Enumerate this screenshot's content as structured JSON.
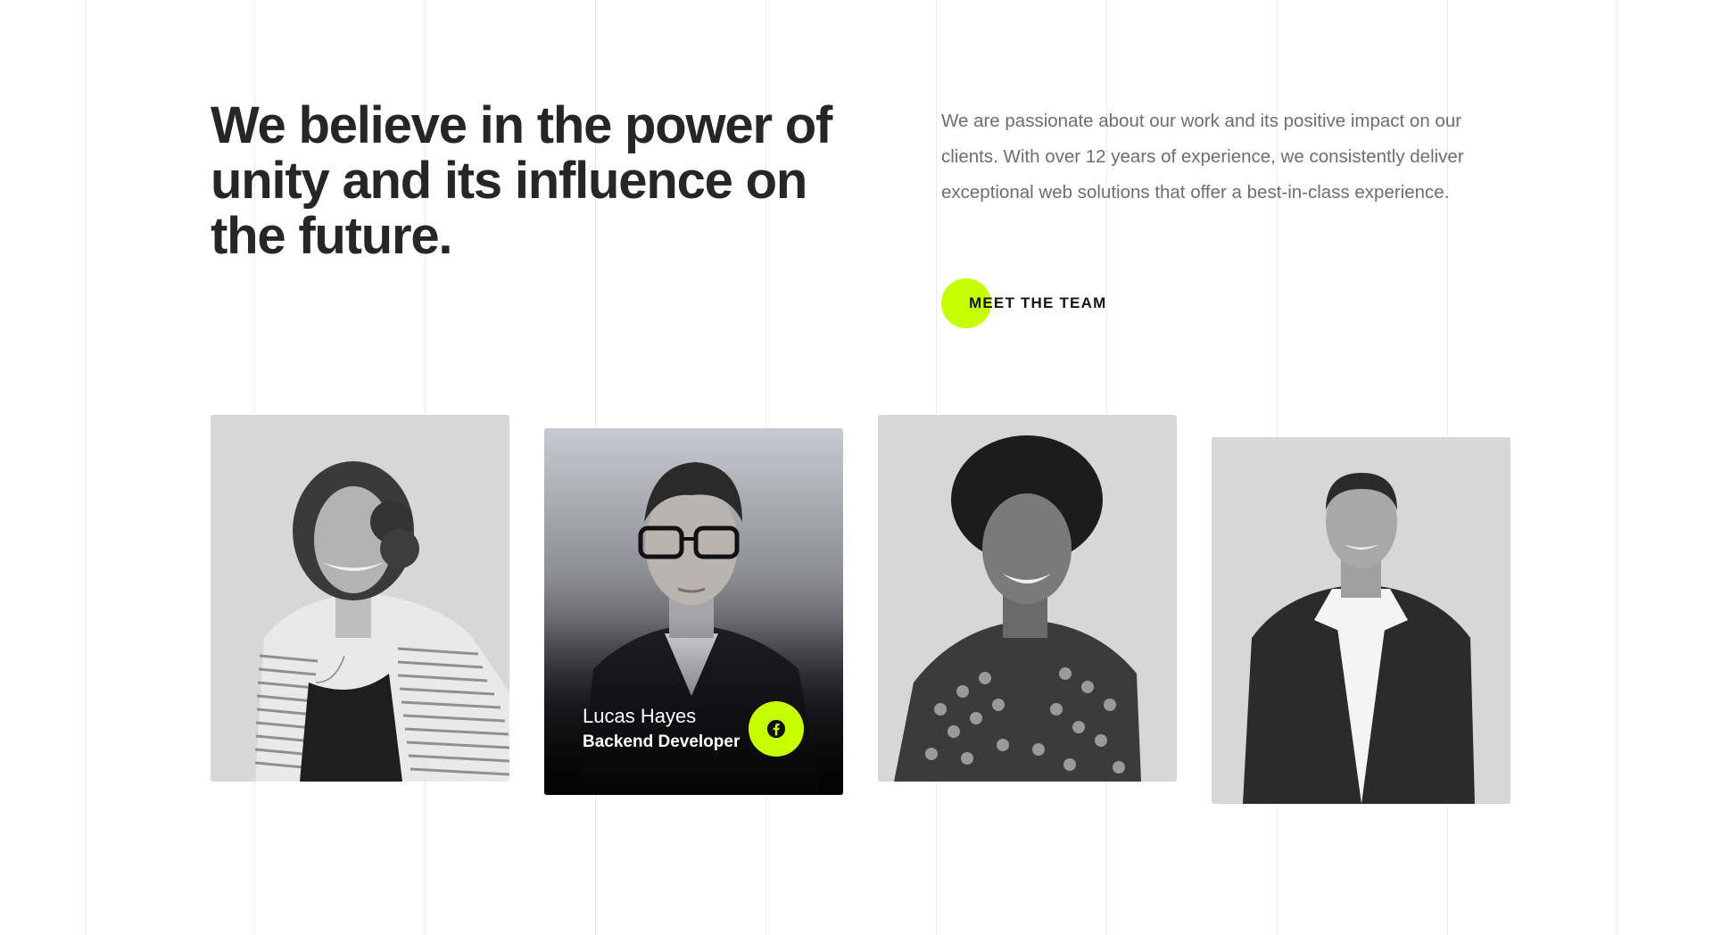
{
  "hero": {
    "headline": "We believe in the power of unity and its influence on the future.",
    "intro": "We are passionate about our work and its positive impact on our clients. With over 12 years of experience, we consistently deliver exceptional web solutions that offer a best-in-class experience.",
    "cta_label": "MEET THE TEAM"
  },
  "team": {
    "members": [
      {
        "photo": "woman-curly-hair-portrait"
      },
      {
        "photo": "man-glasses-portrait",
        "name": "Lucas Hayes",
        "role": "Backend Developer",
        "social_icon": "facebook-icon"
      },
      {
        "photo": "woman-afro-portrait"
      },
      {
        "photo": "man-suit-portrait"
      }
    ]
  },
  "colors": {
    "accent": "#c6ff00",
    "heading": "#262626",
    "body_text": "#6e6e6e",
    "grid_lines": "#ececec",
    "card_bg": "#d6d6d6"
  }
}
